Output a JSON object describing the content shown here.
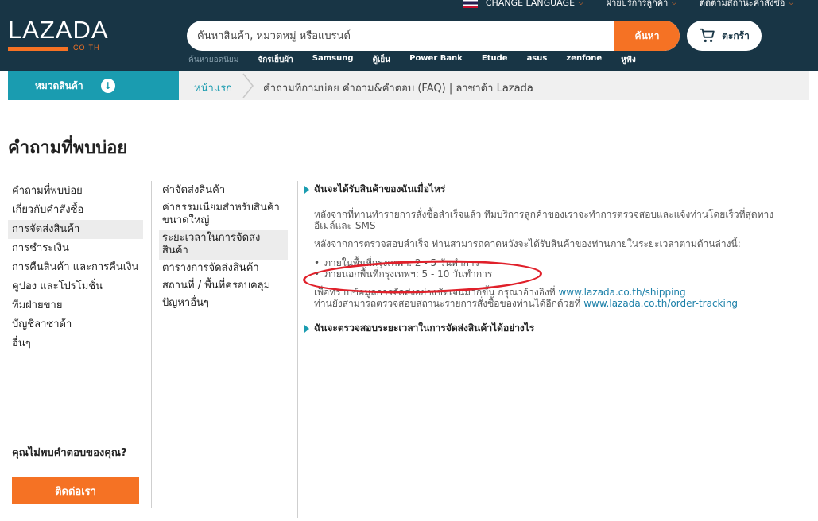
{
  "topbar": {
    "language": "CHANGE LANGUAGE",
    "customer_service": "ฝ่ายบริการลูกค้า",
    "track_order": "ติดตามสถานะคำสั่งซื้อ"
  },
  "logo": {
    "name": "LAZADA",
    "tld": "·CO·TH"
  },
  "search": {
    "placeholder": "ค้นหาสินค้า, หมวดหมู่ หรือแบรนด์",
    "button": "ค้นหา"
  },
  "cart": {
    "label": "ตะกร้า"
  },
  "popular": {
    "label": "ค้นหายอดนิยม",
    "keywords": [
      "จักรเย็บผ้า",
      "Samsung",
      "ตู้เย็น",
      "Power Bank",
      "Etude",
      "asus",
      "zenfone",
      "หูฟัง"
    ]
  },
  "breadcrumb": {
    "category_button": "หมวดสินค้า",
    "home": "หน้าแรก",
    "current": "คำถามที่ถามบ่อย คำถาม&คำตอบ (FAQ) | ลาซาด้า Lazada"
  },
  "page_title": "คำถามที่พบบ่อย",
  "left_nav": [
    "คำถามที่พบบ่อย",
    "เกี่ยวกับคำสั่งซื้อ",
    "การจัดส่งสินค้า",
    "การชำระเงิน",
    "การคืนสินค้า และการคืนเงิน",
    "คูปอง และโปรโมชั่น",
    "ทีมฝ่ายขาย",
    "บัญชีลาซาด้า",
    "อื่นๆ"
  ],
  "help": {
    "question": "คุณไม่พบคำตอบของคุณ?",
    "contact_button": "ติดต่อเรา"
  },
  "sub_nav": [
    "ค่าจัดส่งสินค้า",
    "ค่าธรรมเนียมสำหรับสินค้าขนาดใหญ่",
    "ระยะเวลาในการจัดส่งสินค้า",
    "ตารางการจัดส่งสินค้า",
    "สถานที่ / พื้นที่ครอบคลุม",
    "ปัญหาอื่นๆ"
  ],
  "content": {
    "q1": "ฉันจะได้รับสินค้าของฉันเมื่อไหร่",
    "p1": "หลังจากที่ท่านทำรายการสั่งซื้อสำเร็จแล้ว ทีมบริการลูกค้าของเราจะทำการตรวจสอบและแจ้งท่านโดยเร็วที่สุดทางอีเมล์และ SMS",
    "p2": "หลังจากการตรวจสอบสำเร็จ ท่านสามารถคาดหวังจะได้รับสินค้าของท่านภายในระยะเวลาตามด้านล่างนี้:",
    "b1": "ภายในพื้นที่กรุงเทพฯ: 2 - 5 วันทำการ",
    "b2": "ภายนอกพื้นที่กรุงเทพฯ: 5 - 10 วันทำการ",
    "p3_pre": "เพื่อทราบข้อมูลการจัดส่งอย่างชัดเจนมากขึ้น กรุณาอ้างอิงที่ ",
    "p3_link": "www.lazada.co.th/shipping",
    "p4_pre": "ท่านยังสามารถตรวจสอบสถานะรายการสั่งซื้อของท่านได้อีกด้วยที่ ",
    "p4_link": "www.lazada.co.th/order-tracking",
    "q2": "ฉันจะตรวจสอบระยะเวลาในการจัดส่งสินค้าได้อย่างไร"
  },
  "colors": {
    "header": "#183545",
    "accent": "#f57224",
    "teal": "#1a9cb0",
    "annotation": "#e0202a"
  }
}
